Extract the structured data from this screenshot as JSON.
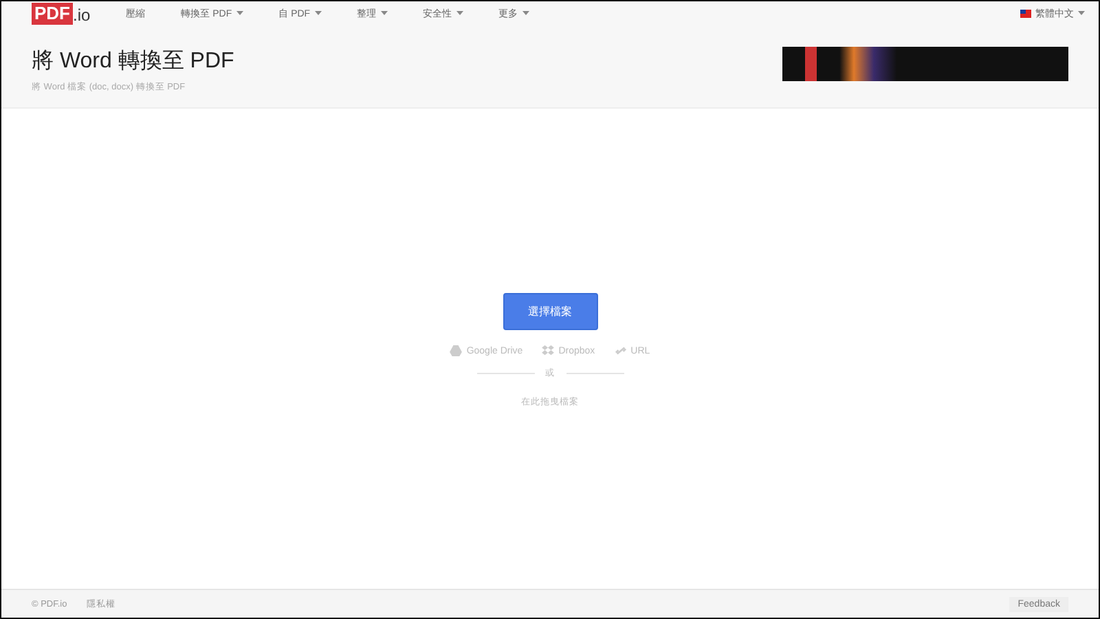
{
  "nav": {
    "logo_main": "PDF",
    "logo_suffix": ".io",
    "items": [
      {
        "label": "壓縮",
        "dropdown": false
      },
      {
        "label": "轉換至 PDF",
        "dropdown": true
      },
      {
        "label": "自 PDF",
        "dropdown": true
      },
      {
        "label": "整理",
        "dropdown": true
      },
      {
        "label": "安全性",
        "dropdown": true
      },
      {
        "label": "更多",
        "dropdown": true
      }
    ],
    "language": "繁體中文"
  },
  "header": {
    "title": "將 Word 轉換至 PDF",
    "subtitle": "將 Word 檔案 (doc, docx) 轉換至 PDF"
  },
  "upload": {
    "button": "選擇檔案",
    "sources": [
      {
        "kind": "drive",
        "label": "Google Drive"
      },
      {
        "kind": "dropbox",
        "label": "Dropbox"
      },
      {
        "kind": "url",
        "label": "URL"
      }
    ],
    "separator": "或",
    "drop_hint": "在此拖曳檔案"
  },
  "footer": {
    "copyright": "© PDF.io",
    "privacy": "隱私權",
    "feedback": "Feedback"
  }
}
